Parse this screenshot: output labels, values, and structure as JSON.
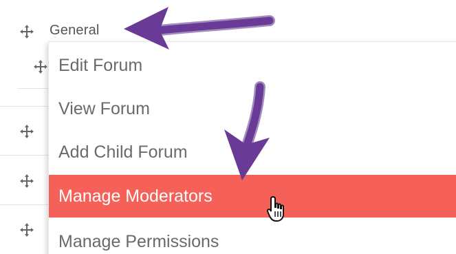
{
  "tree": {
    "group_label": "General"
  },
  "menu": {
    "items": [
      {
        "label": "Edit Forum"
      },
      {
        "label": "View Forum"
      },
      {
        "label": "Add Child Forum"
      },
      {
        "label": "Manage Moderators",
        "active": true
      },
      {
        "label": "Manage Permissions"
      }
    ]
  },
  "colors": {
    "active_bg": "#f56159",
    "arrow": "#6a3a97",
    "menu_text": "#6a6a6a"
  },
  "icons": {
    "move": "move-arrows-icon",
    "cursor": "hand-pointer-icon",
    "annotation": "annotation-arrow"
  }
}
